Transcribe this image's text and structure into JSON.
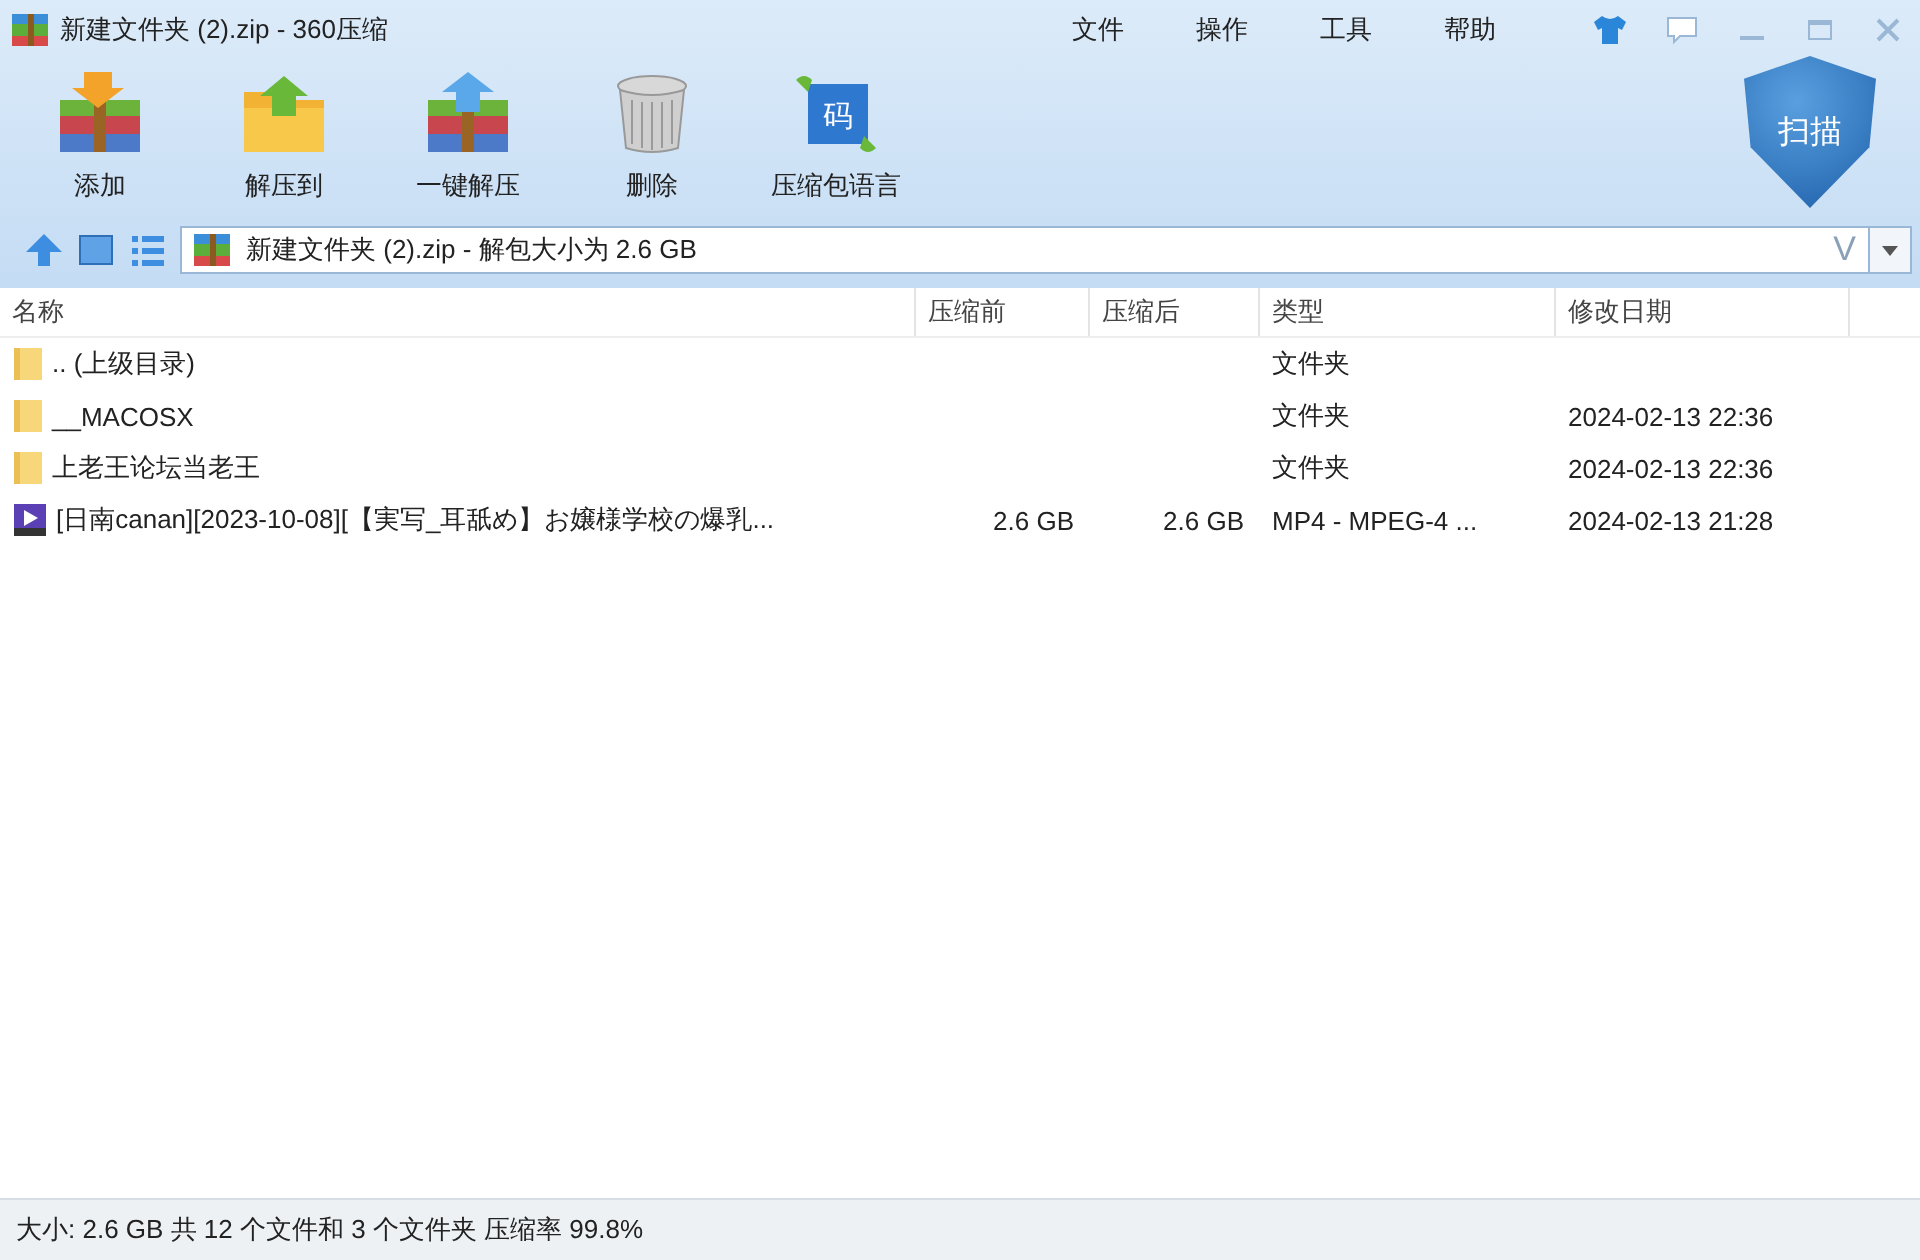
{
  "window": {
    "title": "新建文件夹 (2).zip - 360压缩"
  },
  "menu": [
    "文件",
    "操作",
    "工具",
    "帮助"
  ],
  "toolbar": [
    {
      "label": "添加",
      "kind": "add"
    },
    {
      "label": "解压到",
      "kind": "extract-to"
    },
    {
      "label": "一键解压",
      "kind": "extract"
    },
    {
      "label": "删除",
      "kind": "delete"
    },
    {
      "label": "压缩包语言",
      "kind": "language",
      "glyph": "码"
    }
  ],
  "scan_button": "扫描",
  "address": {
    "value": "新建文件夹 (2).zip - 解包大小为 2.6 GB",
    "badge": "V"
  },
  "table": {
    "columns": [
      "名称",
      "压缩前",
      "压缩后",
      "类型",
      "修改日期"
    ],
    "rows": [
      {
        "kind": "folder",
        "cells": [
          ".. (上级目录)",
          "",
          "",
          "文件夹",
          ""
        ]
      },
      {
        "kind": "folder",
        "cells": [
          "__MACOSX",
          "",
          "",
          "文件夹",
          "2024-02-13 22:36"
        ]
      },
      {
        "kind": "folder",
        "cells": [
          "上老王论坛当老王",
          "",
          "",
          "文件夹",
          "2024-02-13 22:36"
        ]
      },
      {
        "kind": "video",
        "cells": [
          "[日南canan][2023-10-08][【実写_耳舐め】お嬢様学校の爆乳...",
          "2.6 GB",
          "2.6 GB",
          "MP4 - MPEG-4 ...",
          "2024-02-13 21:28"
        ]
      }
    ]
  },
  "status_bar": "大小: 2.6 GB 共 12 个文件和 3 个文件夹 压缩率 99.8%"
}
